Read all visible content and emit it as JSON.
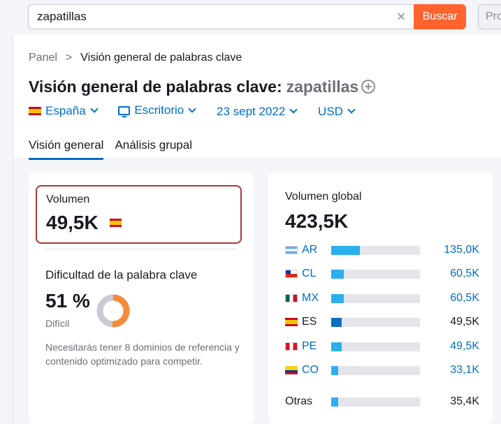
{
  "search": {
    "value": "zapatillas",
    "clear_glyph": "×",
    "submit_label": "Buscar",
    "side_button_label": "Pro"
  },
  "breadcrumb": {
    "root": "Panel",
    "separator": ">",
    "current": "Visión general de palabras clave"
  },
  "title": {
    "prefix": "Visión general de palabras clave:",
    "keyword": "zapatillas",
    "add_glyph": "+"
  },
  "filters": {
    "country": "España",
    "device": "Escritorio",
    "date": "23 sept 2022",
    "currency": "USD"
  },
  "tabs": [
    {
      "label": "Visión general",
      "active": true
    },
    {
      "label": "Análisis grupal",
      "active": false
    }
  ],
  "volume": {
    "label": "Volumen",
    "value": "49,5K",
    "country_flag": "spain-flag-icon"
  },
  "difficulty": {
    "label": "Dificultad de la palabra clave",
    "value": "51 %",
    "level": "Difícil",
    "percent": 51,
    "color": "#f58c3b",
    "note": "Necesitarás tener 8 dominios de referencia y contenido optimizado para competir."
  },
  "global_volume": {
    "label": "Volumen global",
    "value": "423,5K",
    "rows": [
      {
        "code": "AR",
        "flag": "argentina-flag-icon",
        "value": "135,0K",
        "share": 0.32,
        "link": true
      },
      {
        "code": "CL",
        "flag": "chile-flag-icon",
        "value": "60,5K",
        "share": 0.14,
        "link": true
      },
      {
        "code": "MX",
        "flag": "mexico-flag-icon",
        "value": "60,5K",
        "share": 0.14,
        "link": true
      },
      {
        "code": "ES",
        "flag": "spain-flag-icon",
        "value": "49,5K",
        "share": 0.12,
        "link": false
      },
      {
        "code": "PE",
        "flag": "peru-flag-icon",
        "value": "49,5K",
        "share": 0.12,
        "link": true
      },
      {
        "code": "CO",
        "flag": "colombia-flag-icon",
        "value": "33,1K",
        "share": 0.08,
        "link": true
      }
    ],
    "other": {
      "label": "Otras",
      "value": "35,4K",
      "share": 0.08
    }
  },
  "colors": {
    "accent": "#006dca",
    "brand_button": "#ff642d",
    "bar": "#2bb0ed",
    "bar_highlight": "#0b6fc1",
    "highlight_box": "#a63a3a"
  }
}
